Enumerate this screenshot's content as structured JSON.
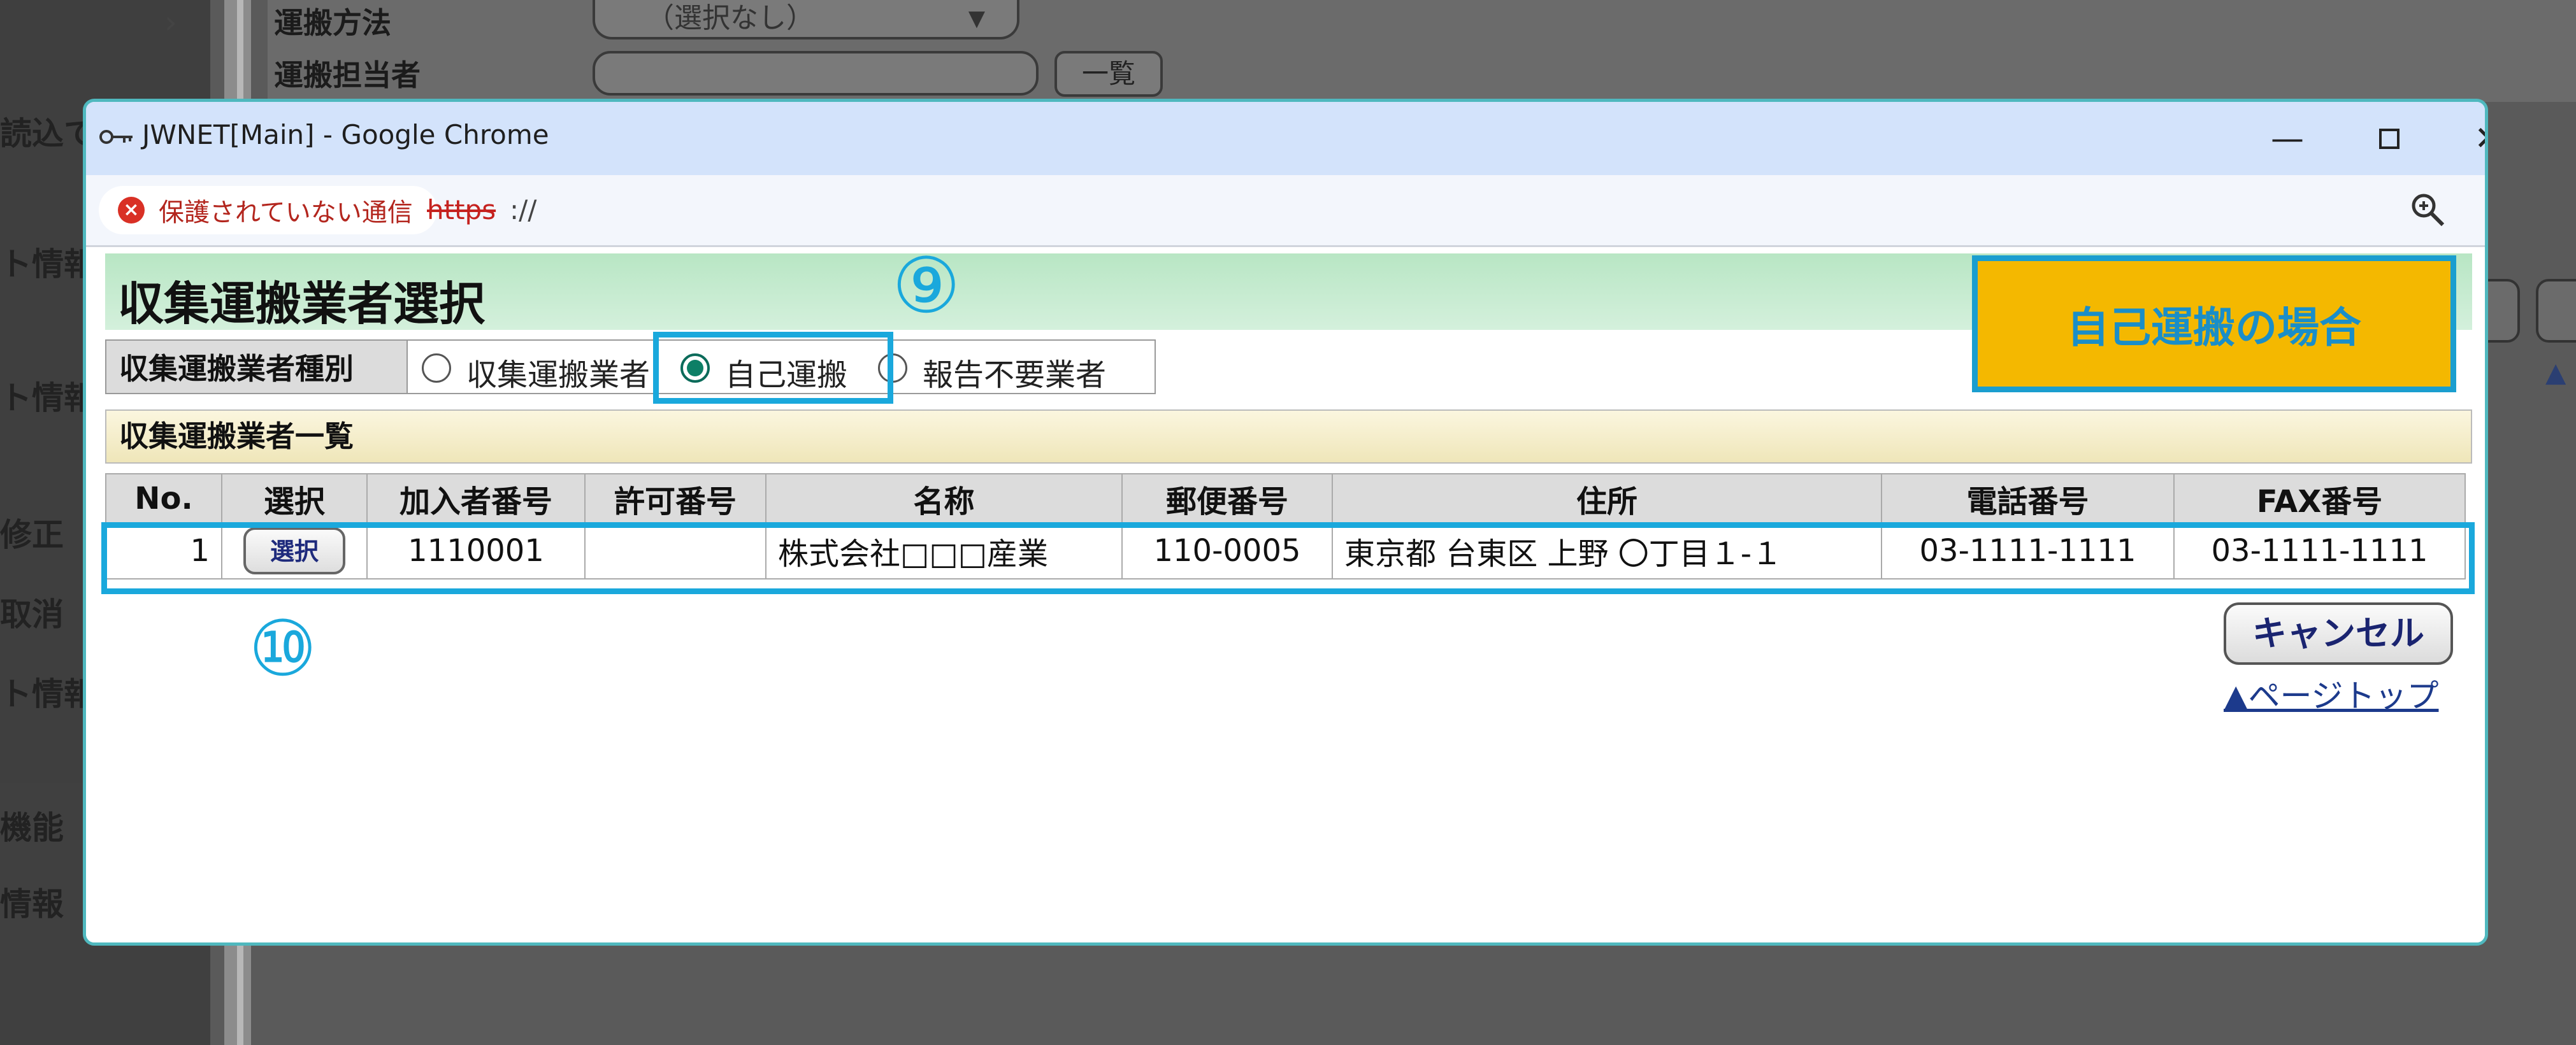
{
  "background": {
    "left_nav": [
      "読込て",
      "ト情報",
      "ト情報",
      "修正",
      "取消",
      "ト情報",
      "機能",
      "情報"
    ],
    "form_labels": [
      "運搬方法",
      "運搬担当者"
    ],
    "select_value": "（選択なし）",
    "list_button": "一覧"
  },
  "window": {
    "title": "JWNET[Main] - Google Chrome",
    "security_label": "保護されていない通信",
    "url_protocol": "https",
    "url_rest": "://"
  },
  "page": {
    "title": "収集運搬業者選択",
    "step9": "⑨",
    "step10": "⑩",
    "case_badge": "自己運搬の場合",
    "kind_label": "収集運搬業者種別",
    "kind_options": [
      "収集運搬業者",
      "自己運搬",
      "報告不要業者"
    ],
    "kind_selected": "自己運搬",
    "list_title": "収集運搬業者一覧",
    "columns": [
      "No.",
      "選択",
      "加入者番号",
      "許可番号",
      "名称",
      "郵便番号",
      "住所",
      "電話番号",
      "FAX番号"
    ],
    "rows": [
      {
        "no": "1",
        "select_label": "選択",
        "member_no": "1110001",
        "permit_no": "",
        "name": "株式会社□□□産業",
        "postal": "110-0005",
        "address": "東京都 台東区 上野 〇丁目１-１",
        "phone": "03-1111-1111",
        "fax": "03-1111-1111"
      }
    ],
    "cancel_label": "キャンセル",
    "page_top_label": "▲ページトップ"
  },
  "colors": {
    "highlight": "#1aa8dc",
    "badge_bg": "#f4b800",
    "header_green": "#b8e6c4",
    "radio_selected": "#0d7f66"
  }
}
